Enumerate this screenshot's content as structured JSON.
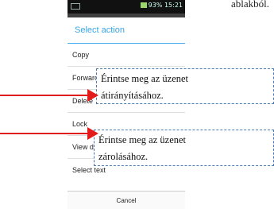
{
  "top_text": "ablakból.",
  "status_bar": {
    "battery_percent": "93%",
    "time": "15:21"
  },
  "dialog": {
    "title": "Select action",
    "items": [
      "Copy",
      "Forward",
      "Delete",
      "Lock",
      "View de",
      "Select text"
    ],
    "cancel": "Cancel"
  },
  "callouts": {
    "forward": {
      "line1": "Érintse meg az üzenet",
      "line2": "átirányításához."
    },
    "lock": {
      "line1": "Érintse meg az üzenet",
      "line2": "zárolásához."
    }
  },
  "colors": {
    "accent": "#3aa5e8",
    "arrow": "#e21b1b",
    "callout_border": "#4a78b0"
  }
}
